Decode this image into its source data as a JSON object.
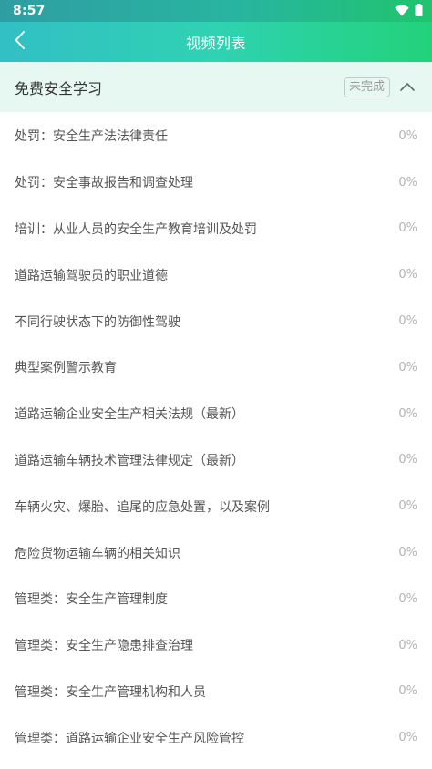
{
  "status_bar": {
    "time": "8:57",
    "icons": [
      "wifi-icon",
      "battery-icon"
    ]
  },
  "header": {
    "title": "视频列表",
    "back_icon": "chevron-left-icon"
  },
  "section": {
    "title": "免费安全学习",
    "status": "未完成",
    "toggle_icon": "chevron-up-icon"
  },
  "colors": {
    "header_gradient_start": "#32bfc5",
    "header_gradient_end": "#22d27a",
    "section_bg": "#e7f8f3"
  },
  "videos": [
    {
      "title": "处罚：安全生产法法律责任",
      "progress": "0%"
    },
    {
      "title": "处罚：安全事故报告和调查处理",
      "progress": "0%"
    },
    {
      "title": "培训：从业人员的安全生产教育培训及处罚",
      "progress": "0%"
    },
    {
      "title": "道路运输驾驶员的职业道德",
      "progress": "0%"
    },
    {
      "title": "不同行驶状态下的防御性驾驶",
      "progress": "0%"
    },
    {
      "title": "典型案例警示教育",
      "progress": "0%"
    },
    {
      "title": "道路运输企业安全生产相关法规（最新）",
      "progress": "0%"
    },
    {
      "title": "道路运输车辆技术管理法律规定（最新）",
      "progress": "0%"
    },
    {
      "title": "车辆火灾、爆胎、追尾的应急处置，以及案例",
      "progress": "0%"
    },
    {
      "title": "危险货物运输车辆的相关知识",
      "progress": "0%"
    },
    {
      "title": "管理类：安全生产管理制度",
      "progress": "0%"
    },
    {
      "title": "管理类：安全生产隐患排查治理",
      "progress": "0%"
    },
    {
      "title": "管理类：安全生产管理机构和人员",
      "progress": "0%"
    },
    {
      "title": "管理类：道路运输企业安全生产风险管控",
      "progress": "0%"
    }
  ]
}
